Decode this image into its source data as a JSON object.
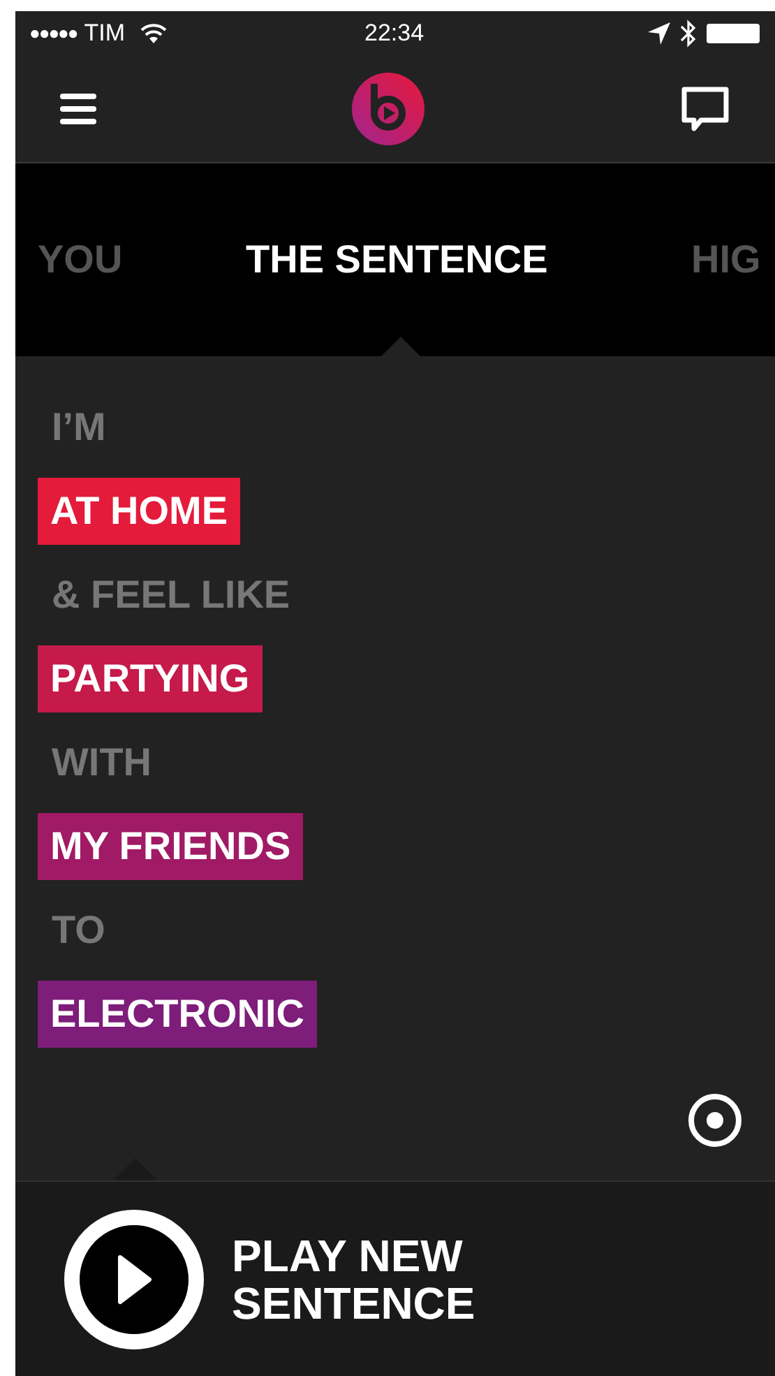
{
  "status_bar": {
    "signal_dots": "●●●●●",
    "carrier": "TIM",
    "time": "22:34"
  },
  "tabs": [
    {
      "label": "YOU",
      "selected": false
    },
    {
      "label": "THE SENTENCE",
      "selected": true
    },
    {
      "label": "HIG",
      "selected": false
    }
  ],
  "sentence": [
    {
      "kind": "text",
      "label": "I’M"
    },
    {
      "kind": "choice",
      "label": "AT HOME",
      "color": "#e41b3a"
    },
    {
      "kind": "text",
      "label": "& FEEL LIKE"
    },
    {
      "kind": "choice",
      "label": "PARTYING",
      "color": "#c51a4a"
    },
    {
      "kind": "text",
      "label": "WITH"
    },
    {
      "kind": "choice",
      "label": "MY FRIENDS",
      "color": "#a01a66"
    },
    {
      "kind": "text",
      "label": "TO"
    },
    {
      "kind": "choice",
      "label": "ELECTRONIC",
      "color": "#7e1d7a"
    }
  ],
  "play_button": {
    "label_lines": [
      "PLAY NEW",
      "SENTENCE"
    ]
  }
}
